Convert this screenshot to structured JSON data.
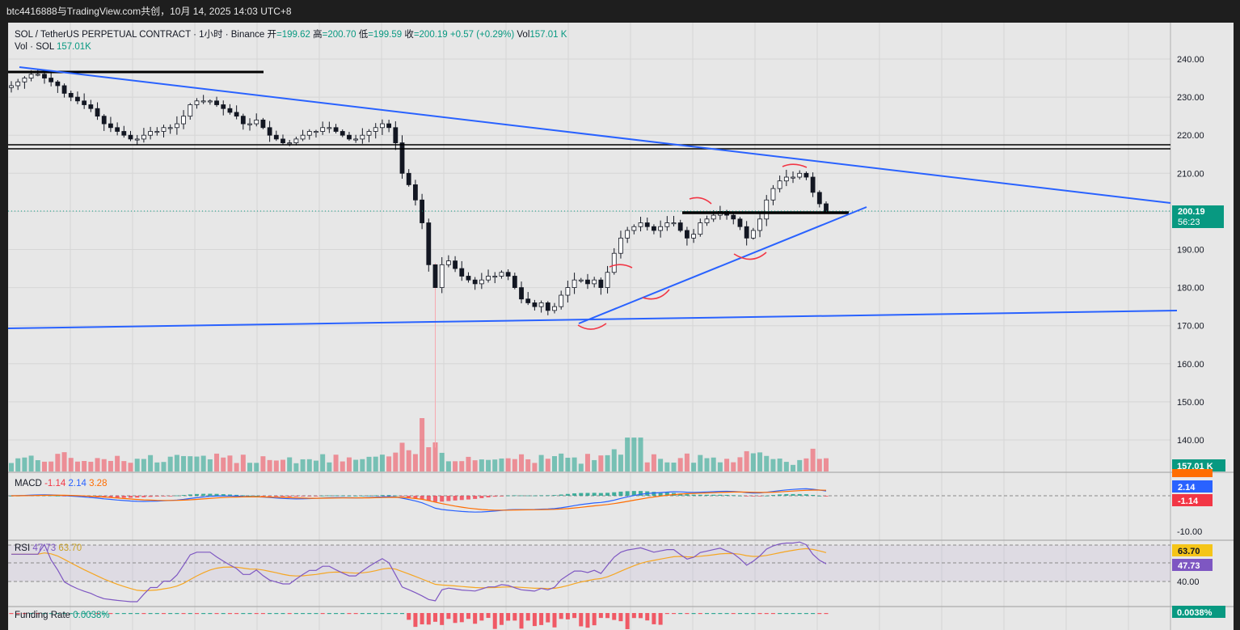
{
  "watermark": "btc4416888与TradingView.com共创，10月 14, 2025 14:03 UTC+8",
  "header": {
    "symbol": "SOL / TetherUS PERPETUAL CONTRACT · 1小时 · Binance",
    "open_label": "开",
    "open": "=199.62",
    "high_label": "高",
    "high": "=200.70",
    "low_label": "低",
    "low": "=199.59",
    "close_label": "收",
    "close": "=200.19",
    "change": "+0.57 (+0.29%)",
    "vol_label": "Vol",
    "vol": "157.01 K"
  },
  "volume_legend": {
    "label": "Vol · SOL",
    "value": "157.01K"
  },
  "macd_legend": {
    "label": "MACD",
    "hist": "-1.14",
    "macd": "2.14",
    "signal": "3.28"
  },
  "rsi_legend": {
    "label": "RSI",
    "rsi": "47.73",
    "ma": "63.70"
  },
  "funding_legend": {
    "label": "Funding Rate",
    "value": "0.0038%"
  },
  "price_tags": {
    "last_price": "200.19",
    "countdown": "56:23",
    "volume": "157.01 K",
    "macd": "2.14",
    "macd_hist": "-1.14",
    "macd_signal_partial": "3.28",
    "rsi_ma": "63.70",
    "rsi": "47.73",
    "funding": "0.0038%"
  },
  "colors": {
    "up": "#089981",
    "down": "#f23645",
    "trendline": "#2962ff",
    "level": "#000000",
    "annotation": "#f23645",
    "macd_line": "#2962ff",
    "signal_line": "#ff6d00",
    "rsi_line": "#7e57c2",
    "rsi_ma_line": "#f5a623"
  },
  "chart_data": {
    "type": "candlestick",
    "symbol": "SOL/USDT",
    "timeframe": "1h",
    "y_axis": {
      "ticks": [
        240,
        230,
        220,
        210,
        200,
        190,
        180,
        170,
        160,
        150,
        140
      ],
      "labels": [
        "240.00",
        "230.00",
        "220.00",
        "210.00",
        "200.00",
        "190.00",
        "180.00",
        "170.00",
        "160.00",
        "150.00",
        "140.00"
      ]
    },
    "macd_axis": {
      "labels": [
        "-10.00"
      ]
    },
    "rsi_axis": {
      "labels": [
        "40.00"
      ]
    },
    "price_path": [
      233,
      234,
      235,
      236,
      236,
      235,
      234,
      233,
      231,
      230,
      229,
      228,
      227,
      225,
      223,
      222,
      221,
      220,
      219,
      219,
      220,
      221,
      221,
      222,
      222,
      223,
      225,
      228,
      229,
      229,
      229,
      228,
      227,
      226,
      225,
      223,
      223,
      224,
      222,
      220,
      219,
      218,
      218,
      219,
      220,
      221,
      221,
      222,
      222,
      221,
      220,
      219,
      219,
      220,
      221,
      222,
      223,
      222,
      218,
      210,
      207,
      203,
      197,
      186,
      180,
      186,
      187,
      185,
      183,
      182,
      181,
      182,
      183,
      183,
      184,
      183,
      180,
      177,
      176,
      175,
      176,
      174,
      175,
      178,
      180,
      182,
      182,
      181,
      182,
      180,
      184,
      189,
      193,
      195,
      196,
      197,
      196,
      195,
      196,
      197,
      197,
      195,
      193,
      194,
      197,
      198,
      199,
      200,
      199,
      198,
      196,
      193,
      195,
      198,
      203,
      206,
      208,
      209,
      209,
      210,
      209,
      205,
      202,
      200
    ],
    "trendlines": [
      {
        "name": "descending resistance",
        "from": [
          0,
          237.6
        ],
        "to": [
          1,
          202.4
        ]
      },
      {
        "name": "rising support",
        "from": [
          0.508,
          171.2
        ],
        "to": [
          0.74,
          200.2
        ]
      },
      {
        "name": "long base line",
        "from": [
          0,
          169.3
        ],
        "to": [
          1,
          173.9
        ]
      }
    ],
    "horizontal_levels": [
      236.8,
      217.4,
      216.4,
      199.8
    ],
    "last_price": 200.19
  }
}
